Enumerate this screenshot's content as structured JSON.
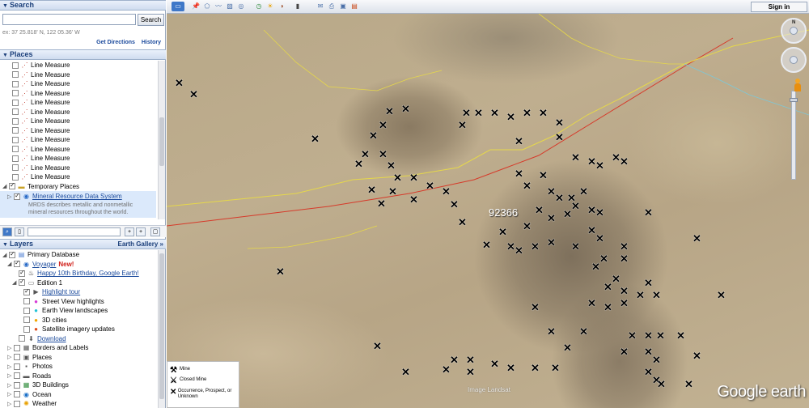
{
  "search": {
    "title": "Search",
    "button": "Search",
    "example": "ex: 37 25.818' N, 122 05.36' W",
    "get_directions": "Get Directions",
    "history": "History"
  },
  "places": {
    "title": "Places",
    "line_measure_items": [
      "Line Measure",
      "Line Measure",
      "Line Measure",
      "Line Measure",
      "Line Measure",
      "Line Measure",
      "Line Measure",
      "Line Measure",
      "Line Measure",
      "Line Measure",
      "Line Measure",
      "Line Measure",
      "Line Measure"
    ],
    "temporary_places": "Temporary Places",
    "mrds_link": "Mineral Resource Data System",
    "mrds_desc": "MRDS describes metallic and nonmetallic mineral resources throughout the world."
  },
  "layers": {
    "title": "Layers",
    "gallery": "Earth Gallery »",
    "primary_db": "Primary Database",
    "voyager": "Voyager",
    "new_tag": "New!",
    "birthday": "Happy 10th Birthday, Google Earth!",
    "edition": "Edition 1",
    "highlight": "Highlight tour",
    "street_view": "Street View highlights",
    "landscapes": "Earth View landscapes",
    "cities": "3D cities",
    "satellite": "Satellite imagery updates",
    "download": "Download",
    "borders": "Borders and Labels",
    "places": "Places",
    "photos": "Photos",
    "roads": "Roads",
    "buildings": "3D Buildings",
    "ocean": "Ocean",
    "weather": "Weather"
  },
  "map": {
    "signin": "Sign in",
    "zip": "92366",
    "image_credit": "Image Landsat",
    "logo": "Google earth",
    "north": "N"
  },
  "legend": {
    "mine": "Mine",
    "closed_mine": "Closed Mine",
    "occurrence": "Occurrence, Prospect, or Unknown"
  }
}
